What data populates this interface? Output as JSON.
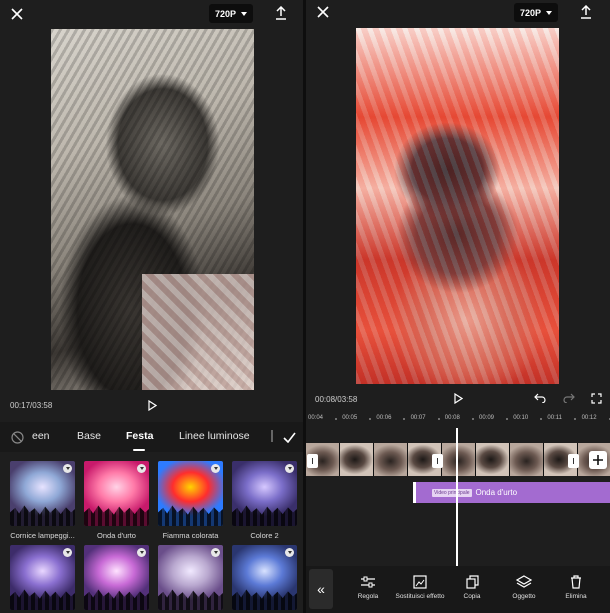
{
  "left": {
    "resolution": "720P",
    "time": "00:17/03:58",
    "tabs": [
      "een",
      "Base",
      "Festa",
      "Linee luminose"
    ],
    "effects": [
      {
        "label": "Cornice lampeggi...",
        "colors": [
          "#8fa8d6",
          "#e7e3ff",
          "#4a3f6d"
        ]
      },
      {
        "label": "Onda d'urto",
        "colors": [
          "#ff7aa8",
          "#ffd3e6",
          "#c81a6b"
        ]
      },
      {
        "label": "Fiamma colorata",
        "colors": [
          "#ff2d2d",
          "#ffd400",
          "#2d7bff"
        ]
      },
      {
        "label": "Colore 2",
        "colors": [
          "#7b6ec9",
          "#d6c8ff",
          "#3a2f6b"
        ]
      },
      {
        "label": "",
        "colors": [
          "#8a6fd0",
          "#e9d7ff",
          "#3d2c6a"
        ]
      },
      {
        "label": "",
        "colors": [
          "#c86ad6",
          "#ffe2ff",
          "#53307a"
        ]
      },
      {
        "label": "",
        "colors": [
          "#b9a8cf",
          "#f1e9ff",
          "#6a4e8a"
        ]
      },
      {
        "label": "",
        "colors": [
          "#5c7ad6",
          "#d8e2ff",
          "#2a3670"
        ]
      }
    ]
  },
  "right": {
    "resolution": "720P",
    "time": "00:08/03:58",
    "ruler": [
      "00:04",
      "00:05",
      "00:06",
      "00:07",
      "00:08",
      "00:09",
      "00:10",
      "00:11",
      "00:12"
    ],
    "track": {
      "tag": "Video principale",
      "name": "Onda d'urto"
    },
    "tools": [
      "Regola",
      "Sostituisci effetto",
      "Copia",
      "Oggetto",
      "Elimina"
    ]
  }
}
